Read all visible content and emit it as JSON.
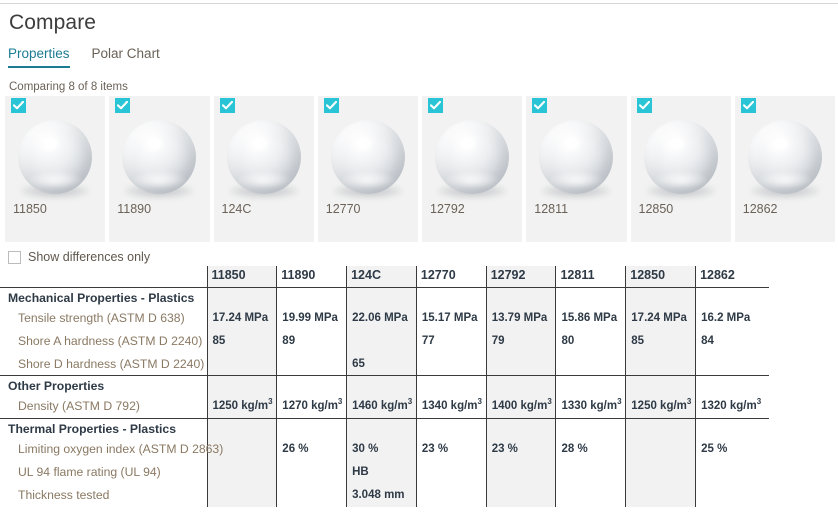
{
  "header": {
    "title": "Compare"
  },
  "tabs": [
    {
      "label": "Properties",
      "active": true
    },
    {
      "label": "Polar Chart",
      "active": false
    }
  ],
  "comparing": {
    "text": "Comparing 8 of 8 items"
  },
  "cards": [
    {
      "label": "11850",
      "checked": true
    },
    {
      "label": "11890",
      "checked": true
    },
    {
      "label": "124C",
      "checked": true
    },
    {
      "label": "12770",
      "checked": true
    },
    {
      "label": "12792",
      "checked": true
    },
    {
      "label": "12811",
      "checked": true
    },
    {
      "label": "12850",
      "checked": true
    },
    {
      "label": "12862",
      "checked": true
    }
  ],
  "show_differences": {
    "label": "Show differences only",
    "checked": false
  },
  "colors": {
    "accent_teal": "#29c5d6",
    "tab_active": "#1c7b93",
    "card_bg": "#f2f2f2",
    "column_shade": "#f2f2f2",
    "label_text": "#8a7963",
    "value_text": "#2e3a46",
    "border": "#3a3a3a"
  },
  "table": {
    "columns": [
      "11850",
      "11890",
      "124C",
      "12770",
      "12792",
      "12811",
      "12850",
      "12862"
    ],
    "groups": [
      {
        "name": "Mechanical Properties - Plastics",
        "rows": [
          {
            "label": "Tensile strength (ASTM D 638)",
            "values": [
              "17.24 MPa",
              "19.99 MPa",
              "22.06 MPa",
              "15.17 MPa",
              "13.79 MPa",
              "15.86 MPa",
              "17.24 MPa",
              "16.2 MPa"
            ]
          },
          {
            "label": "Shore A hardness (ASTM D 2240)",
            "values": [
              "85",
              "89",
              "",
              "77",
              "79",
              "80",
              "85",
              "84"
            ]
          },
          {
            "label": "Shore D hardness (ASTM D 2240)",
            "values": [
              "",
              "",
              "65",
              "",
              "",
              "",
              "",
              ""
            ]
          }
        ]
      },
      {
        "name": "Other Properties",
        "rows": [
          {
            "label": "Density (ASTM D 792)",
            "values": [
              "1250 kg/m³",
              "1270 kg/m³",
              "1460 kg/m³",
              "1340 kg/m³",
              "1400 kg/m³",
              "1330 kg/m³",
              "1250 kg/m³",
              "1320 kg/m³"
            ]
          }
        ]
      },
      {
        "name": "Thermal Properties - Plastics",
        "rows": [
          {
            "label": "Limiting oxygen index (ASTM D 2863)",
            "values": [
              "",
              "26 %",
              "30 %",
              "23 %",
              "23 %",
              "28 %",
              "",
              "25 %"
            ]
          },
          {
            "label": "UL 94 flame rating (UL 94)",
            "values": [
              "",
              "",
              "HB",
              "",
              "",
              "",
              "",
              ""
            ]
          },
          {
            "label": "Thickness tested",
            "values": [
              "",
              "",
              "3.048 mm",
              "",
              "",
              "",
              "",
              ""
            ]
          }
        ]
      }
    ]
  }
}
